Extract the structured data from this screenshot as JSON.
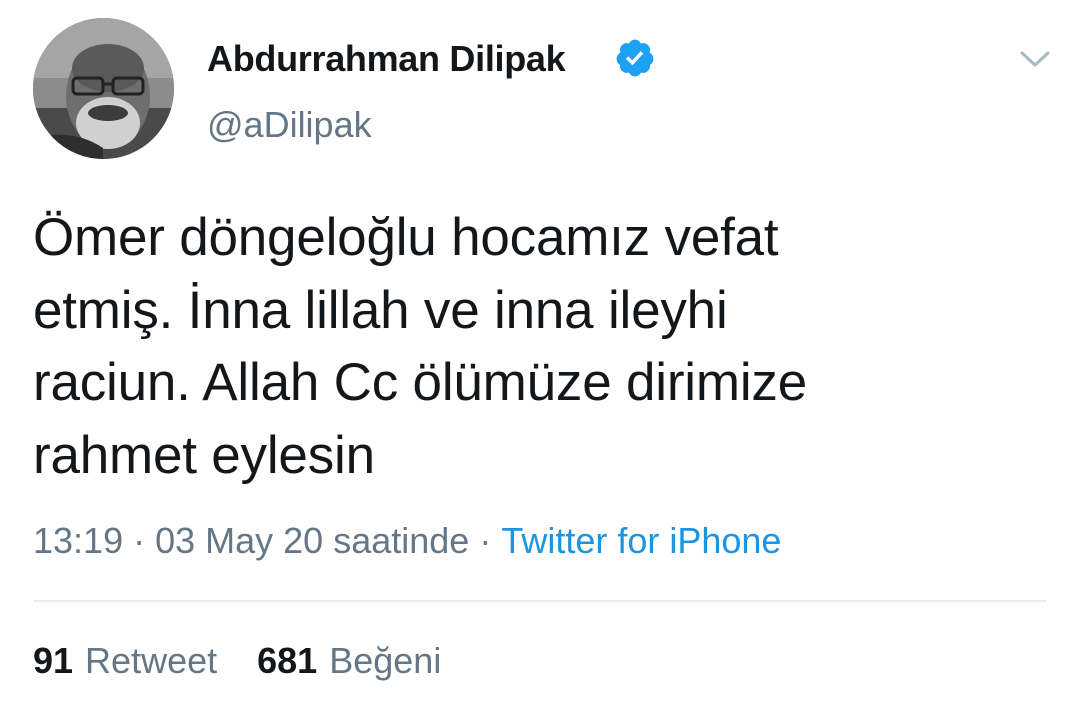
{
  "author": {
    "display_name": "Abdurrahman Dilipak",
    "handle": "@aDilipak",
    "verified": true,
    "verified_color": "#1da1f2"
  },
  "tweet": {
    "text": "Ömer döngeloğlu hocamız vefat\netmiş. İnna lillah ve inna ileyhi\nraciun. Allah Cc ölümüze dirimize\nrahmet eylesin",
    "time": "13:19",
    "separator": "·",
    "date": "03 May 20 saatinde",
    "source": "Twitter for iPhone"
  },
  "stats": {
    "retweets_count": "91",
    "retweets_label": "Retweet",
    "likes_count": "681",
    "likes_label": "Beğeni"
  },
  "colors": {
    "text_primary": "#14171a",
    "text_secondary": "#657786",
    "link": "#1b95e0",
    "divider": "#e6ecf0"
  },
  "icons": {
    "verified": "verified-badge-icon",
    "menu": "chevron-down-icon"
  }
}
